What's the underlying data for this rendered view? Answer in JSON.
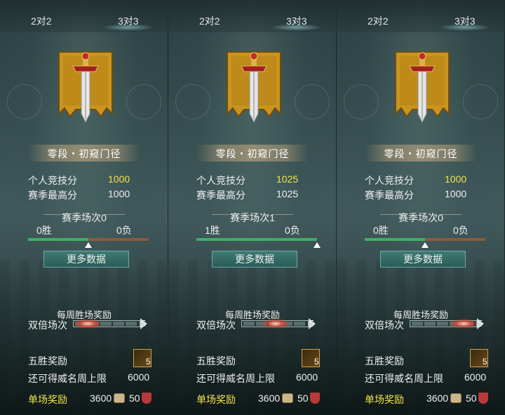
{
  "colors": {
    "highlight_yellow": "#f3e34a",
    "win_green": "#3fae6a",
    "loss_brown": "#8a5b3c",
    "button_teal": "#2f6a64"
  },
  "panels": [
    {
      "tabs": [
        "2对2",
        "3对3"
      ],
      "active_tab": "3对3",
      "emblem_icon": "sword-banner-icon",
      "rank": "零段・初窥门径",
      "personal_score_label": "个人竞技分",
      "personal_score": "1000",
      "season_best_label": "赛季最高分",
      "season_best": "1000",
      "season_matches": "赛季场次0",
      "wins": "0胜",
      "losses": "0负",
      "win_ratio": 0.5,
      "more_data": "更多数据",
      "weekly_title": "每周胜场奖励",
      "double_label": "双倍场次",
      "double_count": "5",
      "double_progress": 0.0,
      "five_win_label": "五胜奖励",
      "five_win_count": "5",
      "fame_limit_label": "还可得威名周上限",
      "fame_limit": "6000",
      "single_reward_label": "单场奖励",
      "coin_reward": "3600",
      "shield_reward": "50"
    },
    {
      "tabs": [
        "2对2",
        "3对3"
      ],
      "active_tab": "3对3",
      "emblem_icon": "sword-banner-icon",
      "rank": "零段・初窥门径",
      "personal_score_label": "个人竞技分",
      "personal_score": "1025",
      "season_best_label": "赛季最高分",
      "season_best": "1025",
      "season_matches": "赛季场次1",
      "wins": "1胜",
      "losses": "0负",
      "win_ratio": 1.0,
      "more_data": "更多数据",
      "weekly_title": "每周胜场奖励",
      "double_label": "双倍场次",
      "double_count": "5",
      "double_progress": 0.5,
      "five_win_label": "五胜奖励",
      "five_win_count": "5",
      "fame_limit_label": "还可得威名周上限",
      "fame_limit": "6000",
      "single_reward_label": "单场奖励",
      "coin_reward": "3600",
      "shield_reward": "50"
    },
    {
      "tabs": [
        "2对2",
        "3对3"
      ],
      "active_tab": "3对3",
      "emblem_icon": "sword-banner-icon",
      "rank": "零段・初窥门径",
      "personal_score_label": "个人竞技分",
      "personal_score": "1000",
      "season_best_label": "赛季最高分",
      "season_best": "1000",
      "season_matches": "赛季场次0",
      "wins": "0胜",
      "losses": "0负",
      "win_ratio": 0.5,
      "more_data": "更多数据",
      "weekly_title": "每周胜场奖励",
      "double_label": "双倍场次",
      "double_count": "5",
      "double_progress": 1.0,
      "five_win_label": "五胜奖励",
      "five_win_count": "5",
      "fame_limit_label": "还可得威名周上限",
      "fame_limit": "6000",
      "single_reward_label": "单场奖励",
      "coin_reward": "3600",
      "shield_reward": "50"
    }
  ]
}
